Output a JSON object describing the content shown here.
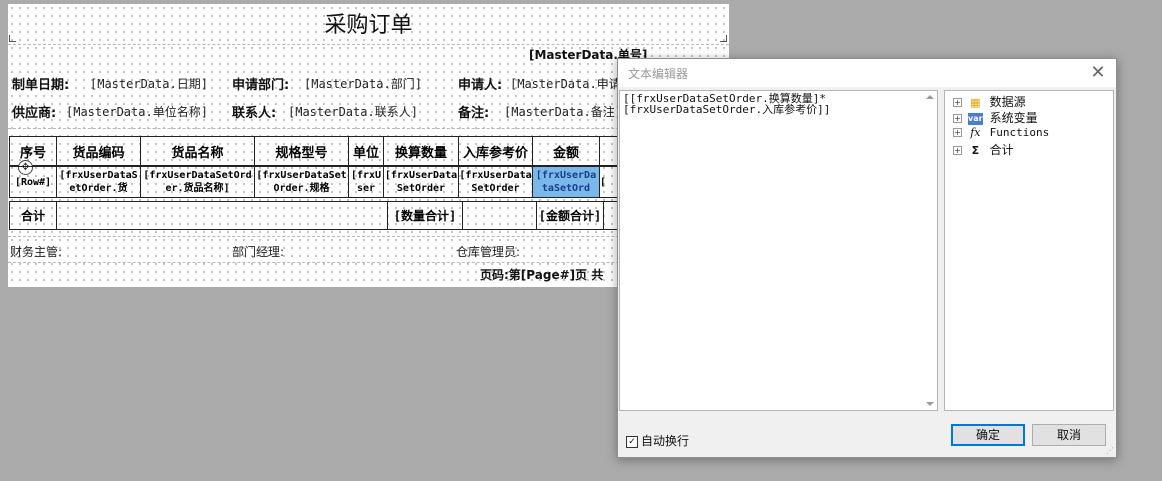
{
  "report": {
    "title": "采购订单",
    "order_no": "[MasterData.单号]",
    "header_fields": [
      {
        "label": "制单日期:",
        "value": "[MasterData.日期]"
      },
      {
        "label": "申请部门:",
        "value": "[MasterData.部门]"
      },
      {
        "label": "申请人:",
        "value": "[MasterData.申请"
      },
      {
        "label": "供应商:",
        "value": "[MasterData.单位名称]"
      },
      {
        "label": "联系人:",
        "value": "[MasterData.联系人]"
      },
      {
        "label": "备注:",
        "value": "[MasterData.备注]"
      }
    ],
    "table_headers": [
      "序号",
      "货品编码",
      "货品名称",
      "规格型号",
      "单位",
      "换算数量",
      "入库参考价",
      "金额",
      ""
    ],
    "data_row": [
      "[Row#]",
      "[frxUserDataSetOrder.货",
      "[frxUserDataSetOrder.货品名称]",
      "[frxUserDataSetOrder.规格",
      "[frxUser",
      "[frxUserDataSetOrder",
      "[frxUserDataSetOrder",
      "[frxUserDataSetOrd",
      "["
    ],
    "summary_row": [
      "合计",
      "",
      "",
      "",
      "",
      "[数量合计]",
      "",
      "[金额合计]",
      ""
    ],
    "footer_fields": [
      "财务主管:",
      "部门经理:",
      "仓库管理员:"
    ],
    "page_footer": "页码:第[Page#]页 共"
  },
  "dialog": {
    "title": "文本编辑器",
    "editor_text": "[[frxUserDataSetOrder.换算数量]*\n[frxUserDataSetOrder.入库参考价]]",
    "tree": [
      {
        "label": "数据源",
        "icon": "database-icon"
      },
      {
        "label": "系统变量",
        "icon": "variable-icon"
      },
      {
        "label": "Functions",
        "icon": "function-icon"
      },
      {
        "label": "合计",
        "icon": "sum-icon"
      }
    ],
    "auto_wrap_label": "自动换行",
    "auto_wrap_checked": true,
    "ok_label": "确定",
    "cancel_label": "取消"
  }
}
